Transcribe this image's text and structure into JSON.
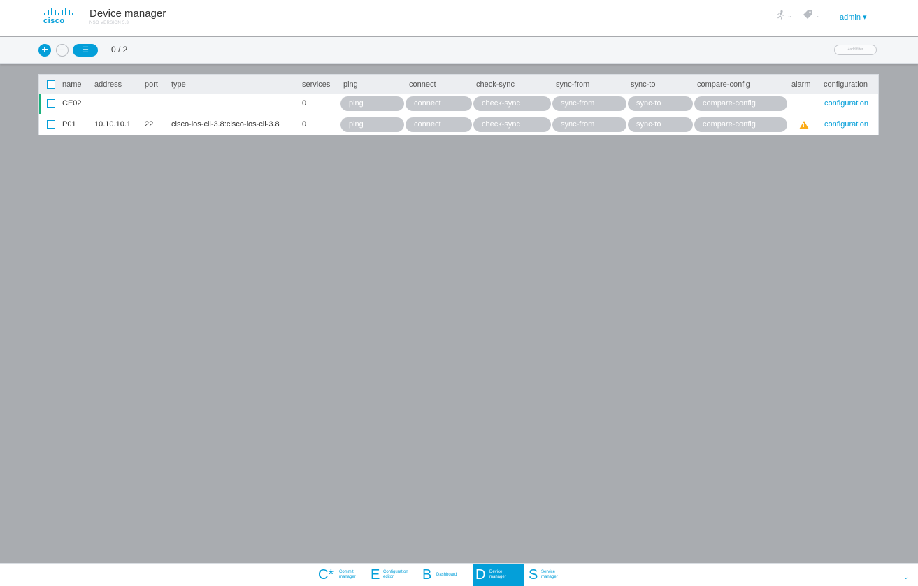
{
  "header": {
    "logo_text": "cisco",
    "title": "Device manager",
    "version": "NSO VERSION 5.3",
    "user": "admin ▾",
    "activity_icon": "runner-icon",
    "tag_icon": "tag-icon"
  },
  "toolbar": {
    "add_icon": "+",
    "remove_icon": "−",
    "list_icon": "☰",
    "count": "0 / 2",
    "add_filter": "+add filter"
  },
  "table": {
    "columns": [
      "name",
      "address",
      "port",
      "type",
      "services",
      "ping",
      "connect",
      "check-sync",
      "sync-from",
      "sync-to",
      "compare-config",
      "alarm",
      "configuration"
    ],
    "rows": [
      {
        "name": "CE02",
        "address": "",
        "port": "",
        "type": "",
        "services": "0",
        "ping": "ping",
        "connect": "connect",
        "check_sync": "check-sync",
        "sync_from": "sync-from",
        "sync_to": "sync-to",
        "compare_config": "compare-config",
        "alarm": "",
        "configuration": "configuration"
      },
      {
        "name": "P01",
        "address": "10.10.10.1",
        "port": "22",
        "type": "cisco-ios-cli-3.8:cisco-ios-cli-3.8",
        "services": "0",
        "ping": "ping",
        "connect": "connect",
        "check_sync": "check-sync",
        "sync_from": "sync-from",
        "sync_to": "sync-to",
        "compare_config": "compare-config",
        "alarm": "warning",
        "configuration": "configuration"
      }
    ]
  },
  "bottom_nav": [
    {
      "letter": "C*",
      "label_1": "Commit",
      "label_2": "manager"
    },
    {
      "letter": "E",
      "label_1": "Configuration",
      "label_2": "editor"
    },
    {
      "letter": "B",
      "label_1": "Dashboard",
      "label_2": ""
    },
    {
      "letter": "D",
      "label_1": "Device",
      "label_2": "manager"
    },
    {
      "letter": "S",
      "label_1": "Service",
      "label_2": "manager"
    }
  ],
  "colors": {
    "accent": "#049fd9",
    "warning": "#fbab18",
    "selected_row": "#1bb27d"
  }
}
